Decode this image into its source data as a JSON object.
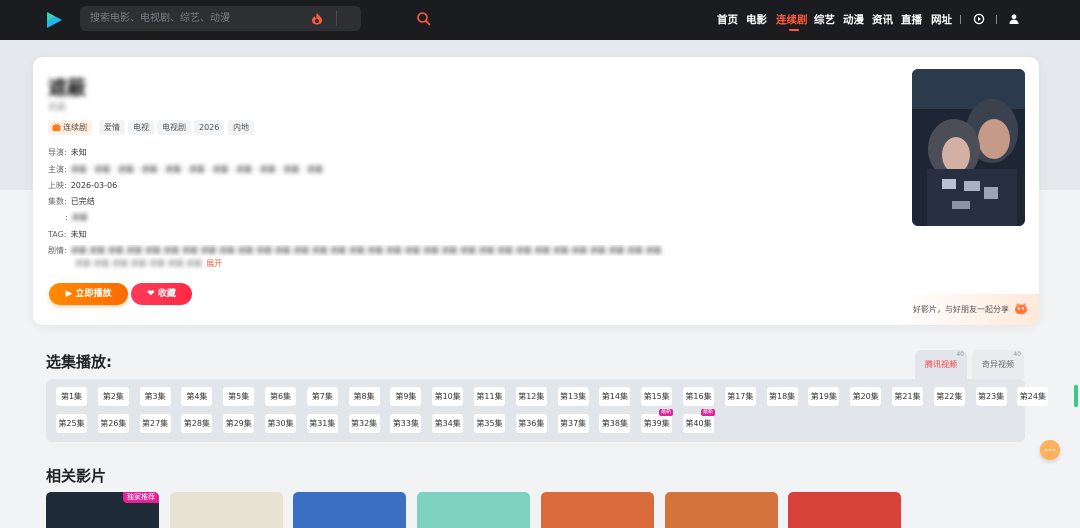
{
  "header": {
    "search_placeholder": "搜索电影、电视剧、综艺、动漫",
    "nav": [
      "首页",
      "电影",
      "连续剧",
      "综艺",
      "动漫",
      "资讯",
      "直播",
      "网址"
    ],
    "active_nav": "连续剧",
    "accent": "#ff5a3c"
  },
  "detail": {
    "title": "遮蔽",
    "subtitle": "遮蔽",
    "tags": [
      "连续剧",
      "爱情",
      "电视",
      "电视剧",
      "2026",
      "内地"
    ],
    "director_label": "导演:",
    "director": "未知",
    "cast_label": "主演:",
    "cast": "遮蔽 · 遮蔽 · 遮蔽 · 遮蔽 · 遮蔽 · 遮蔽 · 遮蔽 · 遮蔽 · 遮蔽 · 遮蔽 · 遮蔽",
    "release_label": "上映:",
    "release": "2026-03-06",
    "episodes_label": "集数:",
    "episodes": "已完结",
    "extra_label": ":",
    "extra": "遮蔽",
    "tag_label": "TAG:",
    "tag": "未知",
    "plot_label": "剧情:",
    "plot": "遮蔽 遮蔽 遮蔽 遮蔽 遮蔽 遮蔽 遮蔽 遮蔽 遮蔽 遮蔽 遮蔽 遮蔽 遮蔽 遮蔽 遮蔽 遮蔽 遮蔽 遮蔽 遮蔽 遮蔽 遮蔽 遮蔽 遮蔽 遮蔽 遮蔽 遮蔽 遮蔽 遮蔽 遮蔽 遮蔽 遮蔽 遮蔽",
    "plot_line2": "遮蔽 遮蔽 遮蔽 遮蔽 遮蔽 遮蔽 遮蔽",
    "expand": "展开",
    "play_button": "立即播放",
    "fav_button": "收藏",
    "share_text": "好影片，与好朋友一起分享"
  },
  "playlist": {
    "title": "选集播放:",
    "sources": [
      {
        "name": "腾讯视频",
        "count": "40"
      },
      {
        "name": "奇异视频",
        "count": "40"
      }
    ],
    "active_source": 0,
    "episodes": [
      "第1集",
      "第2集",
      "第3集",
      "第4集",
      "第5集",
      "第6集",
      "第7集",
      "第8集",
      "第9集",
      "第10集",
      "第11集",
      "第12集",
      "第13集",
      "第14集",
      "第15集",
      "第16集",
      "第17集",
      "第18集",
      "第19集",
      "第20集",
      "第21集",
      "第22集",
      "第23集",
      "第24集",
      "第25集",
      "第26集",
      "第27集",
      "第28集",
      "第29集",
      "第30集",
      "第31集",
      "第32集",
      "第33集",
      "第34集",
      "第35集",
      "第36集",
      "第37集",
      "第38集",
      "第39集",
      "第40集"
    ],
    "new_badge": "最新"
  },
  "related": {
    "title": "相关影片",
    "badge": "独家推荐",
    "colors": [
      "#1e2a36",
      "#e8e2d3",
      "#3b6fc4",
      "#7dd3c0",
      "#d96a3c",
      "#d4733c",
      "#d8423a"
    ]
  }
}
